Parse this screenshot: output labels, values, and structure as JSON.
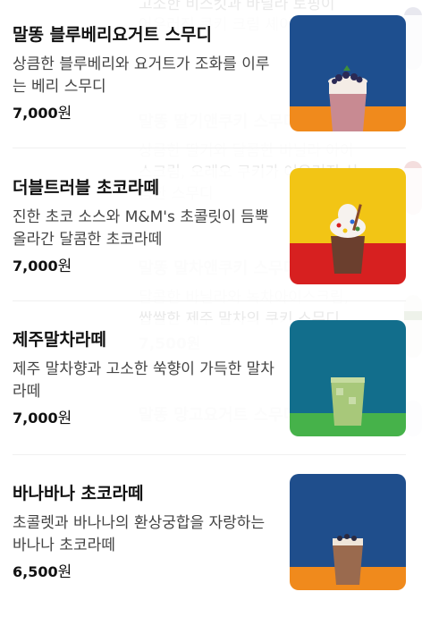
{
  "background_items": [
    {
      "title": "",
      "desc": "고소한 비스킷과 바닐라 토핑이",
      "desc2": "어우러진 쿠키 크림 셰이크"
    },
    {
      "title": "말똥 딸기앤쿠키 스무디",
      "desc": "상큼한 딸기와 달콤한 바닐라 아이",
      "desc2": "스크림, 오레오 쿠키가 어우러진 상",
      "desc3": "큼한 스무디"
    },
    {
      "title": "말똥 말차앤쿠키 스무디",
      "desc": "달콤한 바닐라와 녹차아이스크림,",
      "desc2": "쌉쌀한 제주 말차의 쿠키 스무디",
      "price": "7,500원"
    },
    {
      "title": "말똥 망고요거트 스무디"
    }
  ],
  "menu_items": [
    {
      "name": "말똥 블루베리요거트 스무디",
      "desc": "상큼한 블루베리와 요거트가 조화를 이루는 베리 스무디",
      "price": "7,000",
      "unit": "원",
      "image": "blueberry-yogurt-smoothie-photo",
      "bg_top": "#1e4f8f",
      "bg_bottom": "#f08a1c",
      "drink": "#c88a92",
      "cream": "#f4ece6",
      "topping": "#2b2a55"
    },
    {
      "name": "더블트러블 초코라떼",
      "desc": "진한 초코 소스와 M&M's 초콜릿이 듬뿍 올라간 달콤한 초코라떼",
      "price": "7,000",
      "unit": "원",
      "image": "double-trouble-choco-latte-photo",
      "bg_top": "#f2c515",
      "bg_bottom": "#d72020",
      "drink": "#6b3f2e",
      "cream": "#f6f2ee",
      "topping": "#8a4a2a"
    },
    {
      "name": "제주말차라떼",
      "desc": "제주 말차향과 고소한 쑥향이 가득한 말차라떼",
      "price": "7,000",
      "unit": "원",
      "image": "jeju-matcha-latte-photo",
      "bg_top": "#126e8c",
      "bg_bottom": "#46b24a",
      "drink": "#a8c87a",
      "cream": "#c6dba0",
      "topping": "#a8c87a"
    },
    {
      "name": "바나바나 초코라떼",
      "desc": "초콜렛과 바나나의 환상궁합을 자랑하는 바나나 초코라떼",
      "price": "6,500",
      "unit": "원",
      "image": "banana-choco-latte-photo",
      "bg_top": "#1f4e8c",
      "bg_bottom": "#f08a1c",
      "drink": "#9a6a4e",
      "cream": "#efe6da",
      "topping": "#2b2a40"
    }
  ]
}
